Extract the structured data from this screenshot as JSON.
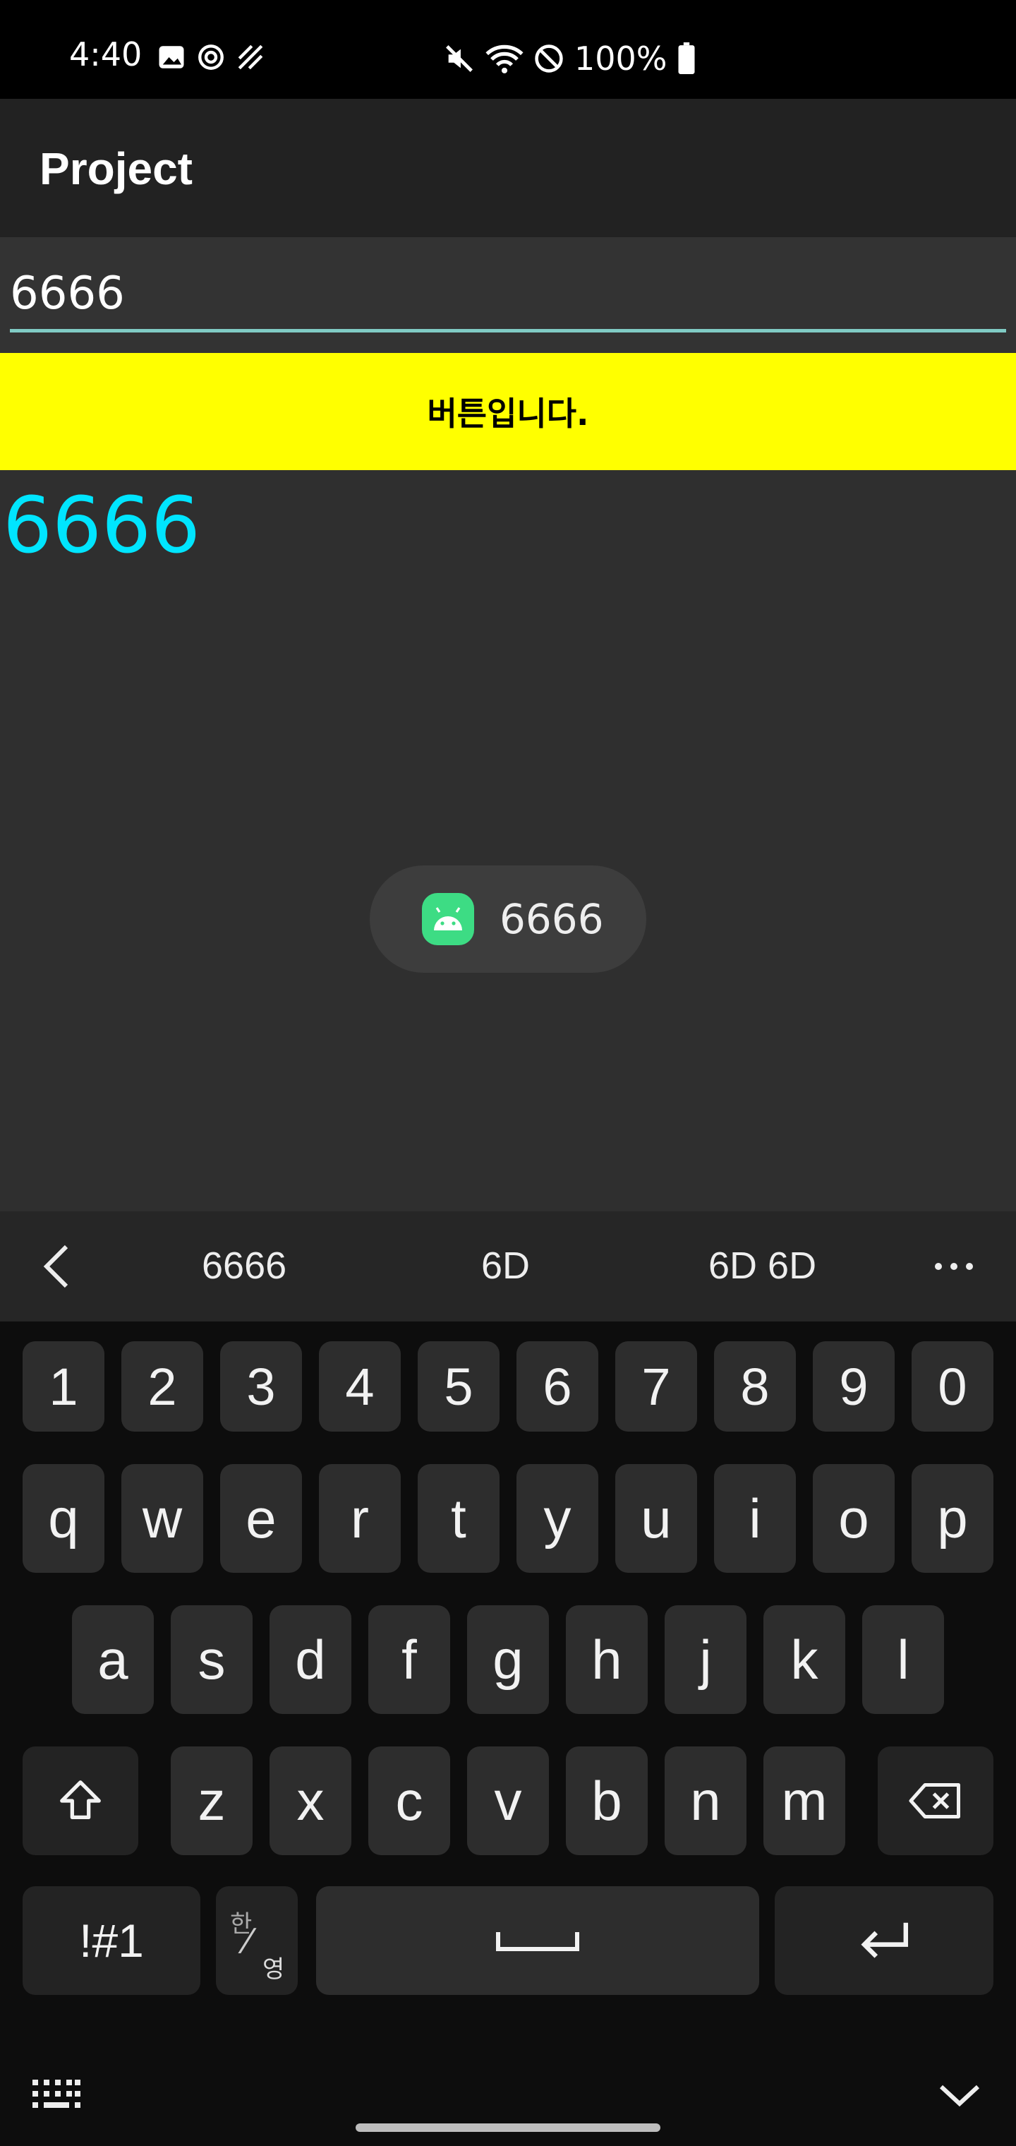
{
  "status_bar": {
    "time": "4:40",
    "left_icons": [
      "gallery-icon",
      "sync-icon",
      "stripes-icon"
    ],
    "right_icons": [
      "mute-icon",
      "wifi-icon",
      "do-not-disturb-icon"
    ],
    "battery": "100%"
  },
  "app_bar": {
    "title": "Project"
  },
  "input": {
    "value": "6666",
    "underline_color": "#80cbc4"
  },
  "button": {
    "label": "버튼입니다.",
    "color": "#ffff00"
  },
  "result": {
    "text": "6666",
    "color": "#00e5ff"
  },
  "toast": {
    "text": "6666",
    "icon": "android-icon"
  },
  "suggestions": {
    "items": [
      "6666",
      "6D",
      "6D 6D"
    ],
    "back_icon": "chevron-left-icon",
    "more_icon": "more-icon"
  },
  "keyboard": {
    "row_numbers": [
      "1",
      "2",
      "3",
      "4",
      "5",
      "6",
      "7",
      "8",
      "9",
      "0"
    ],
    "row1": [
      "q",
      "w",
      "e",
      "r",
      "t",
      "y",
      "u",
      "i",
      "o",
      "p"
    ],
    "row2": [
      "a",
      "s",
      "d",
      "f",
      "g",
      "h",
      "j",
      "k",
      "l"
    ],
    "row3": [
      "z",
      "x",
      "c",
      "v",
      "b",
      "n",
      "m"
    ],
    "symbols_label": "!#1",
    "lang_top": "한",
    "lang_bottom": "영",
    "icons": [
      "shift-icon",
      "backspace-icon",
      "space-icon",
      "enter-icon",
      "keyboard-grid-icon",
      "hide-keyboard-icon"
    ]
  }
}
